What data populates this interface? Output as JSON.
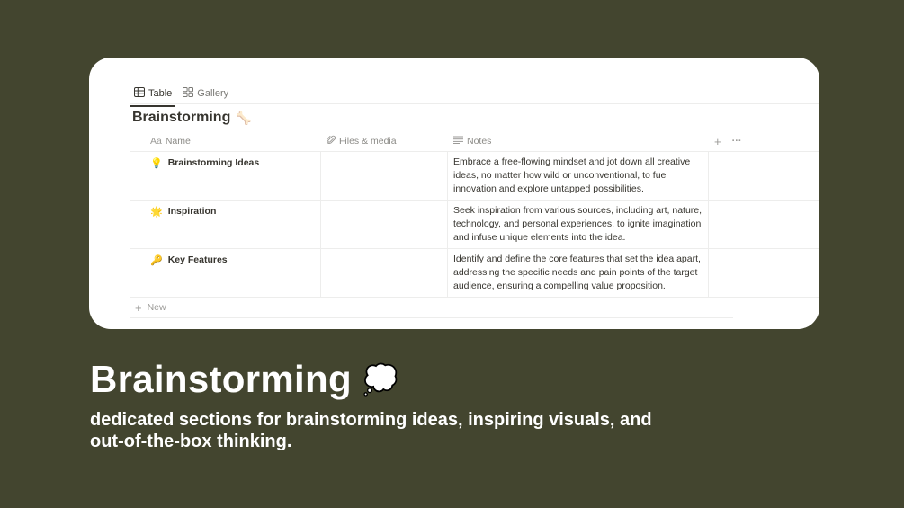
{
  "tabs": [
    {
      "label": "Table",
      "icon": "table-icon",
      "active": true
    },
    {
      "label": "Gallery",
      "icon": "gallery-icon",
      "active": false
    }
  ],
  "database": {
    "title": "Brainstorming",
    "title_icon": "🦴"
  },
  "columns": {
    "name": {
      "prefix": "Aa",
      "label": "Name"
    },
    "files": {
      "label": "Files & media",
      "icon": "paperclip-icon"
    },
    "notes": {
      "label": "Notes",
      "icon": "lines-icon"
    },
    "add_icon": "+",
    "more_icon": "···"
  },
  "rows": [
    {
      "emoji": "💡",
      "name": "Brainstorming Ideas",
      "files": "",
      "notes": "Embrace a free-flowing mindset and jot down all creative ideas, no matter how wild or unconventional, to fuel innovation and explore untapped possibilities."
    },
    {
      "emoji": "🌟",
      "name": "Inspiration",
      "files": "",
      "notes": "Seek inspiration from various sources, including art, nature, technology, and personal experiences, to ignite imagination and infuse unique elements into the idea."
    },
    {
      "emoji": "🔑",
      "name": "Key Features",
      "files": "",
      "notes": "Identify and define the core features that set the idea apart, addressing the specific needs and pain points of the target audience, ensuring a compelling value proposition."
    }
  ],
  "new_row": {
    "icon": "+",
    "label": "New"
  },
  "hero": {
    "title": "Brainstorming",
    "title_emoji": "💭",
    "subtitle": "dedicated sections for brainstorming ideas, inspiring visuals, and out-of-the-box thinking."
  },
  "colors": {
    "background": "#43452f",
    "card": "#ffffff",
    "text": "#37352f"
  }
}
